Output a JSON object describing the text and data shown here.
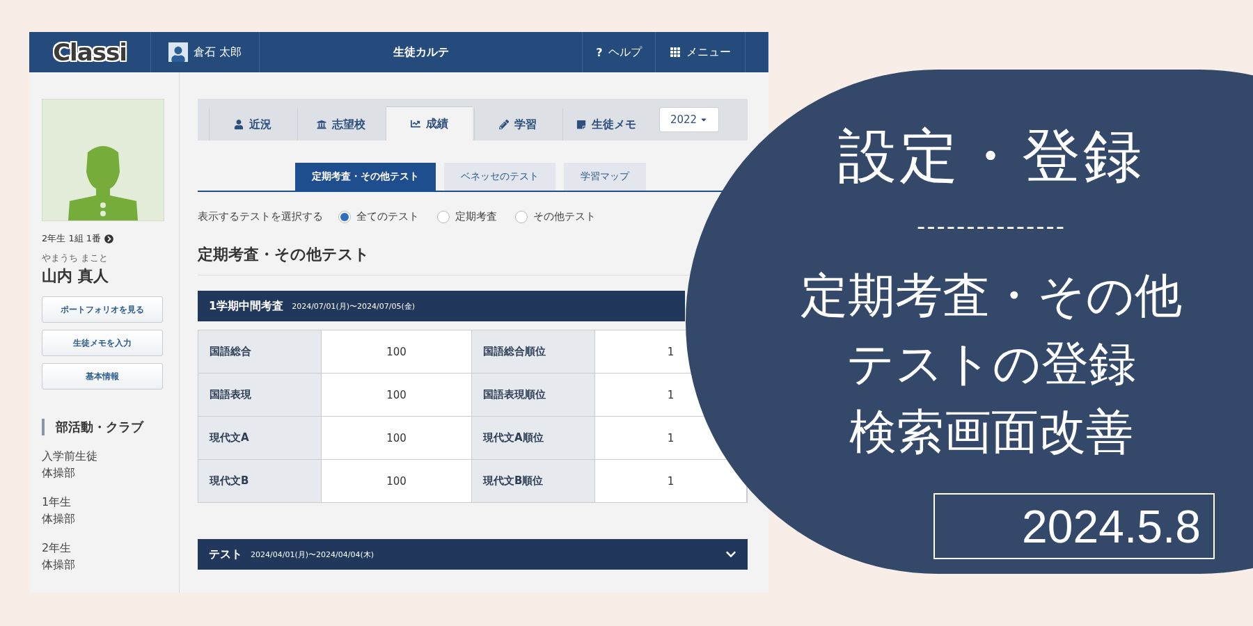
{
  "header": {
    "logo": "Classi",
    "user": "倉石 太郎",
    "title": "生徒カルテ",
    "help_mark": "?",
    "help": "ヘルプ",
    "menu": "メニュー"
  },
  "sidebar": {
    "class_info": "2年生 1組 1番",
    "reading": "やまうち まこと",
    "name": "山内 真人",
    "buttons": [
      "ポートフォリオを見る",
      "生徒メモを入力",
      "基本情報"
    ],
    "clubs_heading": "部活動・クラブ",
    "clubs": [
      {
        "grade": "入学前生徒",
        "club": "体操部"
      },
      {
        "grade": "1年生",
        "club": "体操部"
      },
      {
        "grade": "2年生",
        "club": "体操部"
      }
    ]
  },
  "tabs": [
    {
      "label": "近況",
      "selected": false
    },
    {
      "label": "志望校",
      "selected": false
    },
    {
      "label": "成績",
      "selected": true
    },
    {
      "label": "学習",
      "selected": false
    },
    {
      "label": "生徒メモ",
      "selected": false
    }
  ],
  "year_select": {
    "value": "2022"
  },
  "sub_tabs": [
    {
      "label": "定期考査・その他テスト",
      "selected": true
    },
    {
      "label": "ベネッセのテスト",
      "selected": false
    },
    {
      "label": "学習マップ",
      "selected": false
    }
  ],
  "filter": {
    "label": "表示するテストを選択する",
    "options": [
      {
        "label": "全てのテスト",
        "selected": true
      },
      {
        "label": "定期考査",
        "selected": false
      },
      {
        "label": "その他テスト",
        "selected": false
      }
    ]
  },
  "section_title": "定期考査・その他テスト",
  "exams": [
    {
      "title": "1学期中間考査",
      "dates": "2024/07/01(月)〜2024/07/05(金)",
      "expanded": true,
      "rows": [
        [
          "国語総合",
          "100",
          "国語総合順位",
          "1"
        ],
        [
          "国語表現",
          "100",
          "国語表現順位",
          "1"
        ],
        [
          "現代文A",
          "100",
          "現代文A順位",
          "1"
        ],
        [
          "現代文B",
          "100",
          "現代文B順位",
          "1"
        ]
      ]
    },
    {
      "title": "テスト",
      "dates": "2024/04/01(月)〜2024/04/04(木)",
      "expanded": false
    }
  ],
  "banner": {
    "heading": "設定・登録",
    "divider": "---------------",
    "lines": [
      "定期考査・その他",
      "テストの登録",
      "検索画面改善"
    ],
    "date": "2024.5.8"
  }
}
